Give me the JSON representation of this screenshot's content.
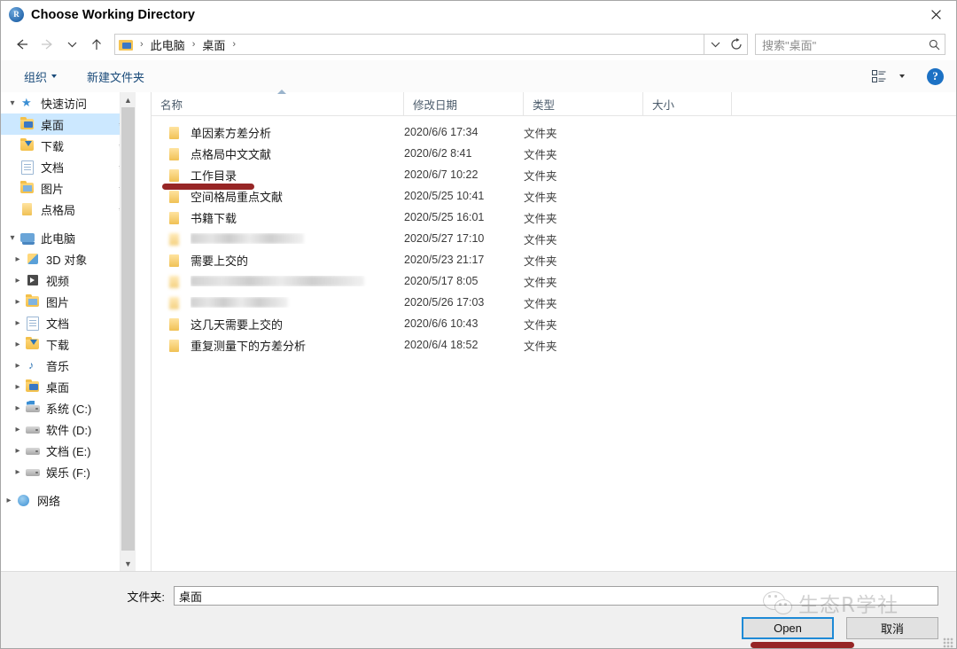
{
  "window": {
    "title": "Choose Working Directory",
    "app_icon": "r-logo-icon",
    "close_label": "✕"
  },
  "nav": {
    "back_icon": "back-arrow-icon",
    "forward_icon": "forward-arrow-icon",
    "recent_icon": "chevron-down-icon",
    "up_icon": "up-arrow-icon",
    "refresh_icon": "refresh-icon",
    "dropdown_icon": "chevron-down-icon",
    "breadcrumb": [
      "此电脑",
      "桌面"
    ],
    "separator": "›"
  },
  "search": {
    "placeholder": "搜索\"桌面\"",
    "icon": "search-icon"
  },
  "toolbar": {
    "organize_label": "组织",
    "new_folder_label": "新建文件夹",
    "view_icon": "list-view-icon",
    "view_caret_icon": "chevron-down-icon",
    "help_label": "?",
    "help_icon": "help-icon"
  },
  "sidebar": {
    "groups": [
      {
        "label": "快速访问",
        "icon": "star-icon",
        "expanded": true,
        "items": [
          {
            "label": "桌面",
            "icon": "desktop-folder-icon",
            "pinned": true,
            "selected": true
          },
          {
            "label": "下载",
            "icon": "downloads-folder-icon",
            "pinned": true,
            "selected": false
          },
          {
            "label": "文档",
            "icon": "documents-folder-icon",
            "pinned": true,
            "selected": false
          },
          {
            "label": "图片",
            "icon": "pictures-folder-icon",
            "pinned": true,
            "selected": false
          },
          {
            "label": "点格局",
            "icon": "folder-icon",
            "pinned": true,
            "selected": false
          }
        ]
      },
      {
        "label": "此电脑",
        "icon": "this-pc-icon",
        "expanded": true,
        "items": [
          {
            "label": "3D 对象",
            "icon": "3d-objects-icon",
            "expandable": true
          },
          {
            "label": "视频",
            "icon": "videos-icon",
            "expandable": true
          },
          {
            "label": "图片",
            "icon": "pictures-folder-icon",
            "expandable": true
          },
          {
            "label": "文档",
            "icon": "documents-folder-icon",
            "expandable": true
          },
          {
            "label": "下载",
            "icon": "downloads-folder-icon",
            "expandable": true
          },
          {
            "label": "音乐",
            "icon": "music-icon",
            "expandable": true
          },
          {
            "label": "桌面",
            "icon": "desktop-folder-icon",
            "expandable": true
          },
          {
            "label": "系统 (C:)",
            "icon": "system-drive-icon",
            "expandable": true
          },
          {
            "label": "软件 (D:)",
            "icon": "drive-icon",
            "expandable": true
          },
          {
            "label": "文档 (E:)",
            "icon": "drive-icon",
            "expandable": true
          },
          {
            "label": "娱乐 (F:)",
            "icon": "drive-icon",
            "expandable": true
          }
        ]
      },
      {
        "label": "网络",
        "icon": "network-icon",
        "expanded": false,
        "items": []
      }
    ],
    "scroll_up_icon": "chevron-up-icon",
    "scroll_down_icon": "chevron-down-icon"
  },
  "filelist": {
    "columns": [
      {
        "label": "名称",
        "sorted": true
      },
      {
        "label": "修改日期",
        "sorted": false
      },
      {
        "label": "类型",
        "sorted": false
      },
      {
        "label": "大小",
        "sorted": false
      }
    ],
    "rows": [
      {
        "name": "单因素方差分析",
        "date": "2020/6/6 17:34",
        "type": "文件夹",
        "size": "",
        "redacted": false
      },
      {
        "name": "点格局中文文献",
        "date": "2020/6/2 8:41",
        "type": "文件夹",
        "size": "",
        "redacted": false
      },
      {
        "name": "工作目录",
        "date": "2020/6/7 10:22",
        "type": "文件夹",
        "size": "",
        "redacted": false,
        "annotated": true
      },
      {
        "name": "空间格局重点文献",
        "date": "2020/5/25 10:41",
        "type": "文件夹",
        "size": "",
        "redacted": false
      },
      {
        "name": "书籍下载",
        "date": "2020/5/25 16:01",
        "type": "文件夹",
        "size": "",
        "redacted": false
      },
      {
        "name": "",
        "date": "2020/5/27 17:10",
        "type": "文件夹",
        "size": "",
        "redacted": true,
        "blur_width": 128
      },
      {
        "name": "需要上交的",
        "date": "2020/5/23 21:17",
        "type": "文件夹",
        "size": "",
        "redacted": false
      },
      {
        "name": "",
        "date": "2020/5/17 8:05",
        "type": "文件夹",
        "size": "",
        "redacted": true,
        "blur_width": 196
      },
      {
        "name": "",
        "date": "2020/5/26 17:03",
        "type": "文件夹",
        "size": "",
        "redacted": true,
        "blur_width": 110
      },
      {
        "name": "这几天需要上交的",
        "date": "2020/6/6 10:43",
        "type": "文件夹",
        "size": "",
        "redacted": false
      },
      {
        "name": "重复测量下的方差分析",
        "date": "2020/6/4 18:52",
        "type": "文件夹",
        "size": "",
        "redacted": false
      }
    ]
  },
  "bottom": {
    "folder_label": "文件夹:",
    "folder_value": "桌面",
    "open_label": "Open",
    "cancel_label": "取消"
  },
  "annotations": {
    "marker_color": "#8e1414",
    "folder_marker": "red-underline-work-directory",
    "open_marker": "red-underline-open-button"
  },
  "watermark": {
    "text": "生态R学社",
    "icon": "wechat-logo-icon"
  }
}
